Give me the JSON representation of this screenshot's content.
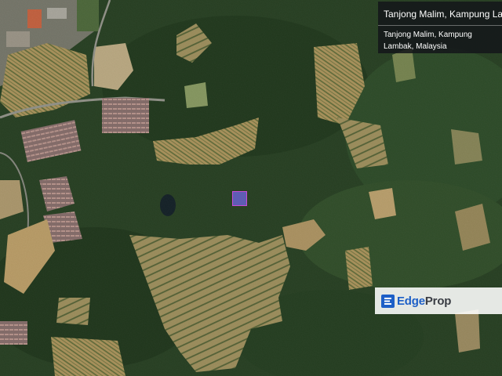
{
  "info_panel": {
    "title": "Tanjong Malim, Kampung Lambak, Ma",
    "address": "Tanjong Malim, Kampung Lambak, Malaysia"
  },
  "watermark": {
    "brand_edge": "Edge",
    "brand_prop": "Prop"
  },
  "colors": {
    "forest_dark": "#1f3a1c",
    "forest_mid": "#2c4a24",
    "cleared_land": "#b59a63",
    "water": "#0e1a24",
    "urban": "#9a8c8c",
    "pin_fill": "#6e64dc",
    "pin_border": "#c84bd6",
    "brand_blue": "#1d5fc7",
    "brand_gray": "#3a3d44"
  },
  "icons": {
    "location_marker": "square-marker",
    "brand_logo": "edgeprop-e-icon"
  }
}
